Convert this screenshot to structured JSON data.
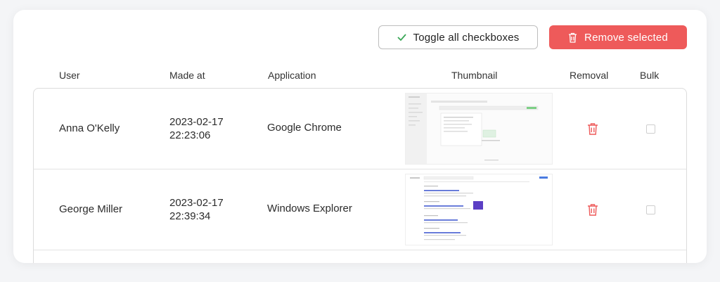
{
  "toolbar": {
    "toggle_label": "Toggle all checkboxes",
    "remove_label": "Remove selected"
  },
  "columns": [
    "User",
    "Made at",
    "Application",
    "Thumbnail",
    "Removal",
    "Bulk"
  ],
  "rows": [
    {
      "user": "Anna O'Kelly",
      "made_date": "2023-02-17",
      "made_time": "22:23:06",
      "application": "Google Chrome",
      "thumbnail": "chrome-app-screenshot"
    },
    {
      "user": "George Miller",
      "made_date": "2023-02-17",
      "made_time": "22:39:34",
      "application": "Windows Explorer",
      "thumbnail": "search-results-screenshot"
    }
  ],
  "colors": {
    "accent_red": "#ee5a5a",
    "check_green": "#3aa757"
  },
  "icons": {
    "toggle": "checkmark-icon",
    "remove": "trash-icon",
    "row_removal": "trash-icon"
  }
}
